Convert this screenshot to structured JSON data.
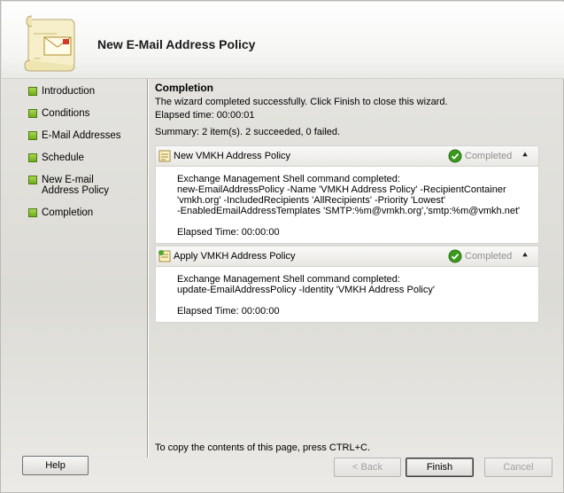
{
  "header": {
    "title": "New E-Mail Address Policy",
    "icon": "email-policy-scroll-icon"
  },
  "nav": {
    "items": [
      {
        "label": "Introduction"
      },
      {
        "label": "Conditions"
      },
      {
        "label": "E-Mail Addresses"
      },
      {
        "label": "Schedule"
      },
      {
        "label": "New E-mail Address Policy"
      },
      {
        "label": "Completion"
      }
    ]
  },
  "main": {
    "section_title": "Completion",
    "message": "The wizard completed successfully. Click Finish to close this wizard.",
    "elapsed": "Elapsed time: 00:00:01",
    "summary": "Summary: 2 item(s). 2 succeeded, 0 failed.",
    "tasks": [
      {
        "title": "New VMKH Address Policy",
        "status": "Completed",
        "lines": [
          "Exchange Management Shell command completed:",
          "new-EmailAddressPolicy -Name 'VMKH Address Policy' -RecipientContainer",
          "'vmkh.org' -IncludedRecipients 'AllRecipients' -Priority 'Lowest'",
          "-EnabledEmailAddressTemplates 'SMTP:%m@vmkh.org','smtp:%m@vmkh.net'"
        ],
        "elapsed": "Elapsed Time: 00:00:00"
      },
      {
        "title": "Apply VMKH Address Policy",
        "status": "Completed",
        "lines": [
          "Exchange Management Shell command completed:",
          "update-EmailAddressPolicy -Identity 'VMKH Address Policy'"
        ],
        "elapsed": "Elapsed Time: 00:00:00"
      }
    ]
  },
  "footer": {
    "copy_hint": "To copy the contents of this page, press CTRL+C.",
    "help": "Help",
    "back": "< Back",
    "finish": "Finish",
    "cancel": "Cancel"
  },
  "colors": {
    "bullet": "#7cbb26",
    "status_text": "#8f8f8f",
    "check": "#3a9b1e"
  }
}
